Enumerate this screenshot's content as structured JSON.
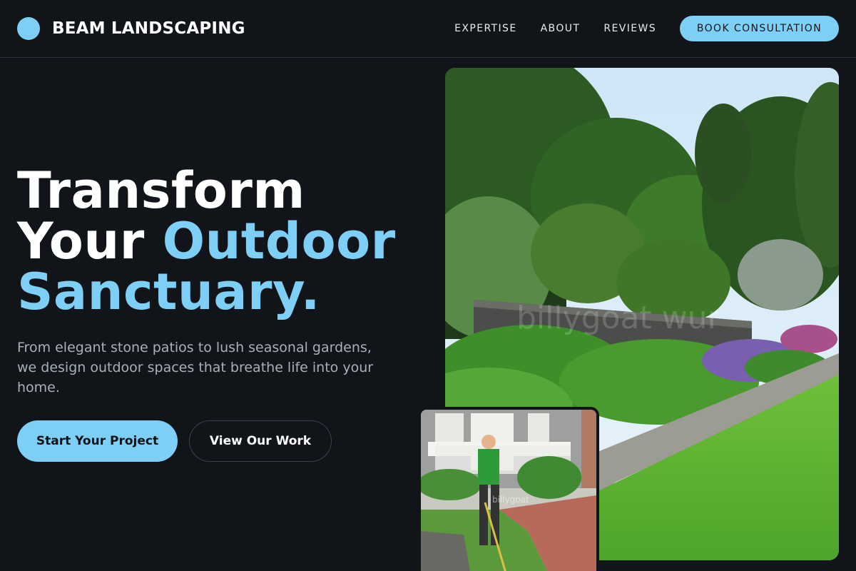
{
  "header": {
    "brand_name": "BEAM LANDSCAPING",
    "nav": [
      "EXPERTISE",
      "ABOUT",
      "REVIEWS"
    ],
    "cta_label": "BOOK CONSULTATION"
  },
  "hero": {
    "headline_line1": "Transform",
    "headline_line2_white": "Your ",
    "headline_line2_accent": "Outdoor",
    "headline_line3_accent": "Sanctuary.",
    "subtext": "From elegant stone patios to lush seasonal gardens, we design outdoor spaces that breathe life into your home.",
    "primary_button": "Start Your Project",
    "secondary_button": "View Our Work"
  },
  "images": {
    "main_watermark": "billygoat wur",
    "inset_watermark": "billygoat"
  },
  "colors": {
    "background": "#11151a",
    "accent": "#7ecff5",
    "text": "#ffffff",
    "muted_text": "#a8b0b8"
  }
}
